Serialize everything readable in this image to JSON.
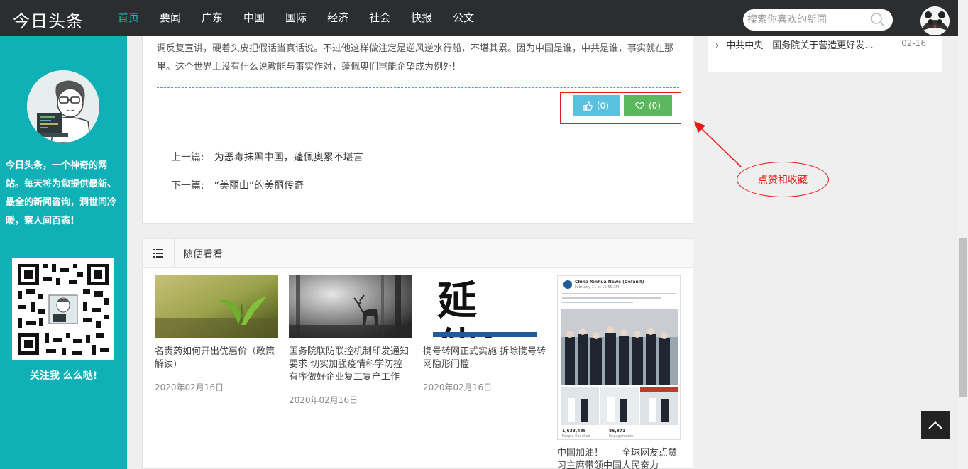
{
  "header": {
    "logo": "今日头条",
    "nav": [
      "首页",
      "要闻",
      "广东",
      "中国",
      "国际",
      "经济",
      "社会",
      "快报",
      "公文"
    ],
    "search_placeholder": "搜索你喜欢的新闻"
  },
  "sidebar": {
    "description": "今日头条，一个神奇的网站。每天将为您提供最新、最全的新闻咨询，洞世间冷暖，察人间百态!",
    "follow": "关注我 么么哒!"
  },
  "article": {
    "text": "调反复宣讲，硬着头皮把假话当真话说。不过他这样做注定是逆风逆水行船，不堪其累。因为中国是谁，中共是谁，事实就在那里。这个世界上没有什么说教能与事实作对，蓬佩奥们岂能企望成为例外!",
    "like_count": "(0)",
    "fav_count": "(0)",
    "prev_label": "上一篇:",
    "prev_title": "为恶毒抹黑中国，蓬佩奥累不堪言",
    "next_label": "下一篇:",
    "next_title": "“美丽山”的美丽传奇"
  },
  "random": {
    "title": "随便看看",
    "items": [
      {
        "title": "名贵药如何开出优惠价（政策解读)",
        "date": "2020年02月16日"
      },
      {
        "title": "国务院联防联控机制印发通知要求 切实加强疫情科学防控 有序做好企业复工复产工作",
        "date": "2020年02月16日"
      },
      {
        "title": "携号转网正式实施 拆除携号转网隐形门槛",
        "date": "2020年02月16日"
      },
      {
        "title": "中国加油！——全球网友点赞习主席带领中国人民奋力",
        "date": ""
      }
    ],
    "img3_text": "延伸：",
    "img4": {
      "account": "China Xinhua News (Default)",
      "time": "February 11 at 12:55 AM",
      "reached": "1,633,485",
      "reached_label": "People Reached",
      "engagements": "86,871",
      "engagements_label": "Engagements"
    }
  },
  "right": {
    "item": "中共中央　国务院关于营造更好发...",
    "date": "02-16"
  },
  "annotation": {
    "label": "点赞和收藏"
  },
  "colors": {
    "teal": "#0fb1b6",
    "nav_bg": "#2b2d2f",
    "like": "#5bc0de",
    "fav": "#5cb85c",
    "annotation": "#e31b1b"
  }
}
